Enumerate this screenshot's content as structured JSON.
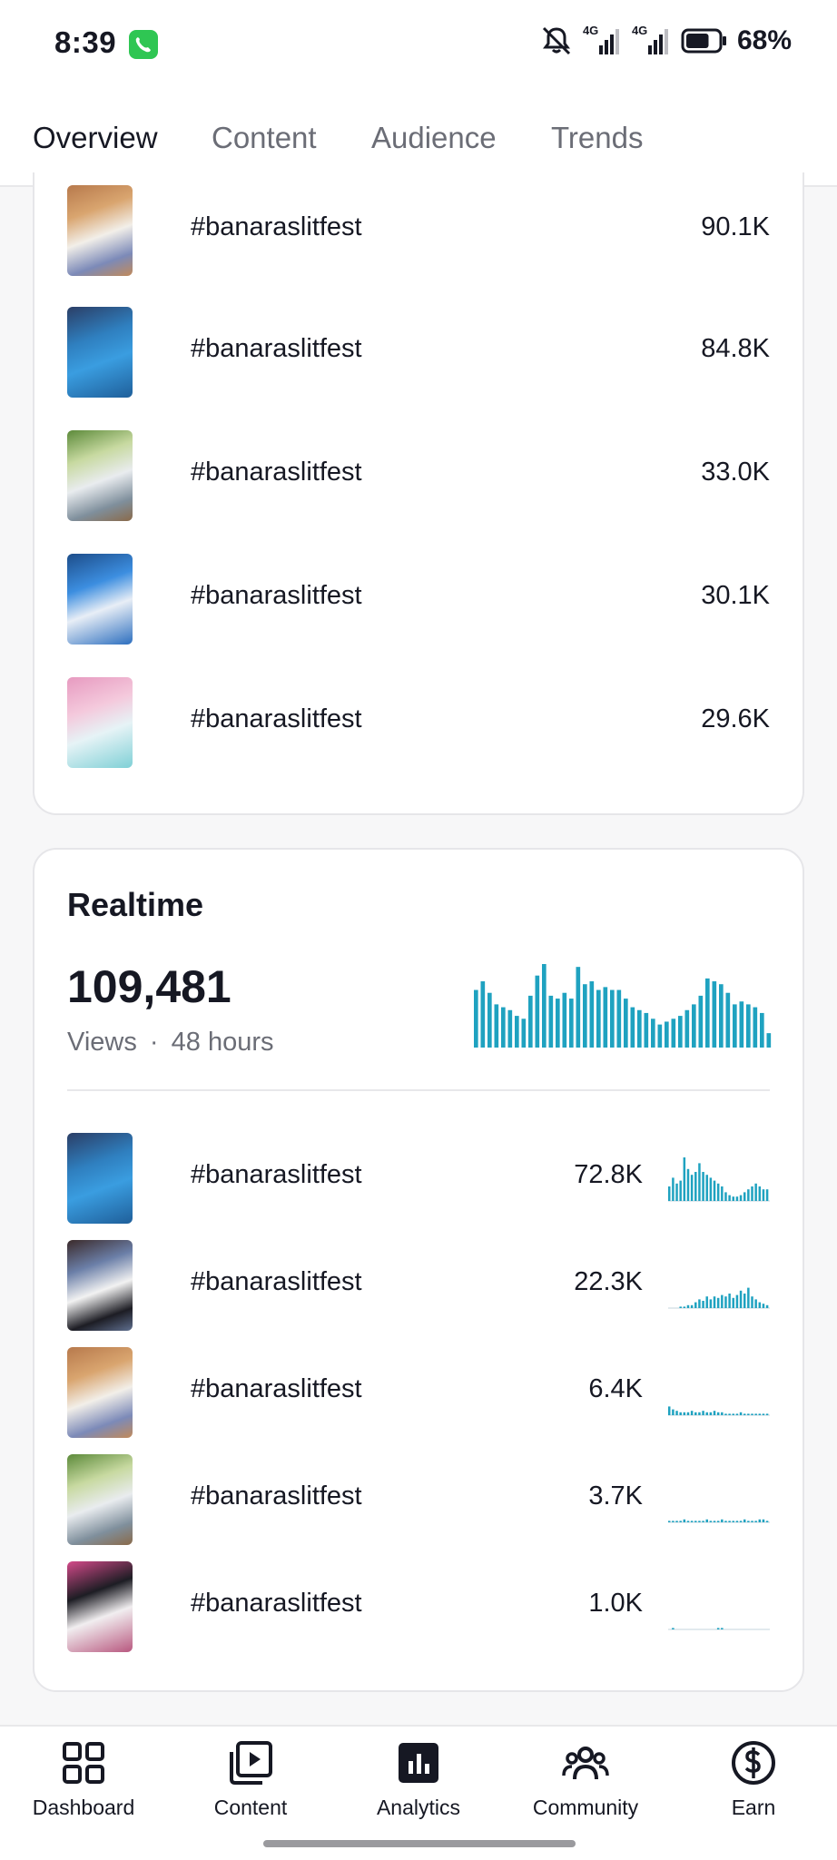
{
  "status_bar": {
    "time": "8:39",
    "network_1": "4G",
    "network_2": "4G",
    "battery_percent": "68%",
    "battery_level": 0.68,
    "icons": [
      "call-icon",
      "silent-bell-icon",
      "signal-icon",
      "battery-icon"
    ]
  },
  "tabs": [
    {
      "label": "Overview",
      "active": true
    },
    {
      "label": "Content",
      "active": false
    },
    {
      "label": "Audience",
      "active": false
    },
    {
      "label": "Trends",
      "active": false
    }
  ],
  "top_videos": [
    {
      "title": "#banaraslitfest",
      "views": "90.1K"
    },
    {
      "title": "#banaraslitfest",
      "views": "84.8K"
    },
    {
      "title": "#banaraslitfest",
      "views": "33.0K"
    },
    {
      "title": "#banaraslitfest",
      "views": "30.1K"
    },
    {
      "title": "#banaraslitfest",
      "views": "29.6K"
    }
  ],
  "realtime": {
    "title": "Realtime",
    "total_views": "109,481",
    "views_label": "Views",
    "separator": "·",
    "period": "48 hours",
    "accent_color": "#1fa2c0",
    "chart_values": [
      40,
      46,
      38,
      30,
      28,
      26,
      22,
      20,
      36,
      50,
      58,
      36,
      34,
      38,
      34,
      56,
      44,
      46,
      40,
      42,
      40,
      40,
      34,
      28,
      26,
      24,
      20,
      16,
      18,
      20,
      22,
      26,
      30,
      36,
      48,
      46,
      44,
      38,
      30,
      32,
      30,
      28,
      24,
      10
    ],
    "videos": [
      {
        "title": "#banaraslitfest",
        "views": "72.8K",
        "trend": [
          10,
          16,
          12,
          14,
          30,
          22,
          18,
          20,
          26,
          20,
          18,
          16,
          14,
          12,
          10,
          6,
          4,
          3,
          3,
          4,
          6,
          8,
          10,
          12,
          10,
          8,
          8
        ]
      },
      {
        "title": "#banaraslitfest",
        "views": "22.3K",
        "trend": [
          0,
          0,
          0,
          1,
          1,
          2,
          2,
          4,
          6,
          5,
          8,
          6,
          8,
          7,
          9,
          8,
          10,
          7,
          9,
          12,
          10,
          14,
          8,
          6,
          4,
          3,
          2
        ]
      },
      {
        "title": "#banaraslitfest",
        "views": "6.4K",
        "trend": [
          6,
          4,
          3,
          2,
          2,
          2,
          3,
          2,
          2,
          3,
          2,
          2,
          3,
          2,
          2,
          1,
          1,
          1,
          1,
          2,
          1,
          1,
          1,
          1,
          1,
          1,
          1
        ]
      },
      {
        "title": "#banaraslitfest",
        "views": "3.7K",
        "trend": [
          1,
          1,
          1,
          1,
          2,
          1,
          1,
          1,
          1,
          1,
          2,
          1,
          1,
          1,
          2,
          1,
          1,
          1,
          1,
          1,
          2,
          1,
          1,
          1,
          2,
          2,
          1
        ]
      },
      {
        "title": "#banaraslitfest",
        "views": "1.0K",
        "trend": [
          0,
          1,
          0,
          0,
          0,
          0,
          0,
          0,
          0,
          0,
          0,
          0,
          0,
          1,
          1,
          0,
          0,
          0,
          0,
          0,
          0,
          0,
          0,
          0,
          0,
          0,
          0
        ]
      }
    ]
  },
  "bottom_nav": [
    {
      "label": "Dashboard",
      "icon": "dashboard-grid-icon",
      "active": false
    },
    {
      "label": "Content",
      "icon": "play-square-icon",
      "active": false
    },
    {
      "label": "Analytics",
      "icon": "bar-chart-icon",
      "active": true
    },
    {
      "label": "Community",
      "icon": "people-icon",
      "active": false
    },
    {
      "label": "Earn",
      "icon": "dollar-circle-icon",
      "active": false
    }
  ]
}
